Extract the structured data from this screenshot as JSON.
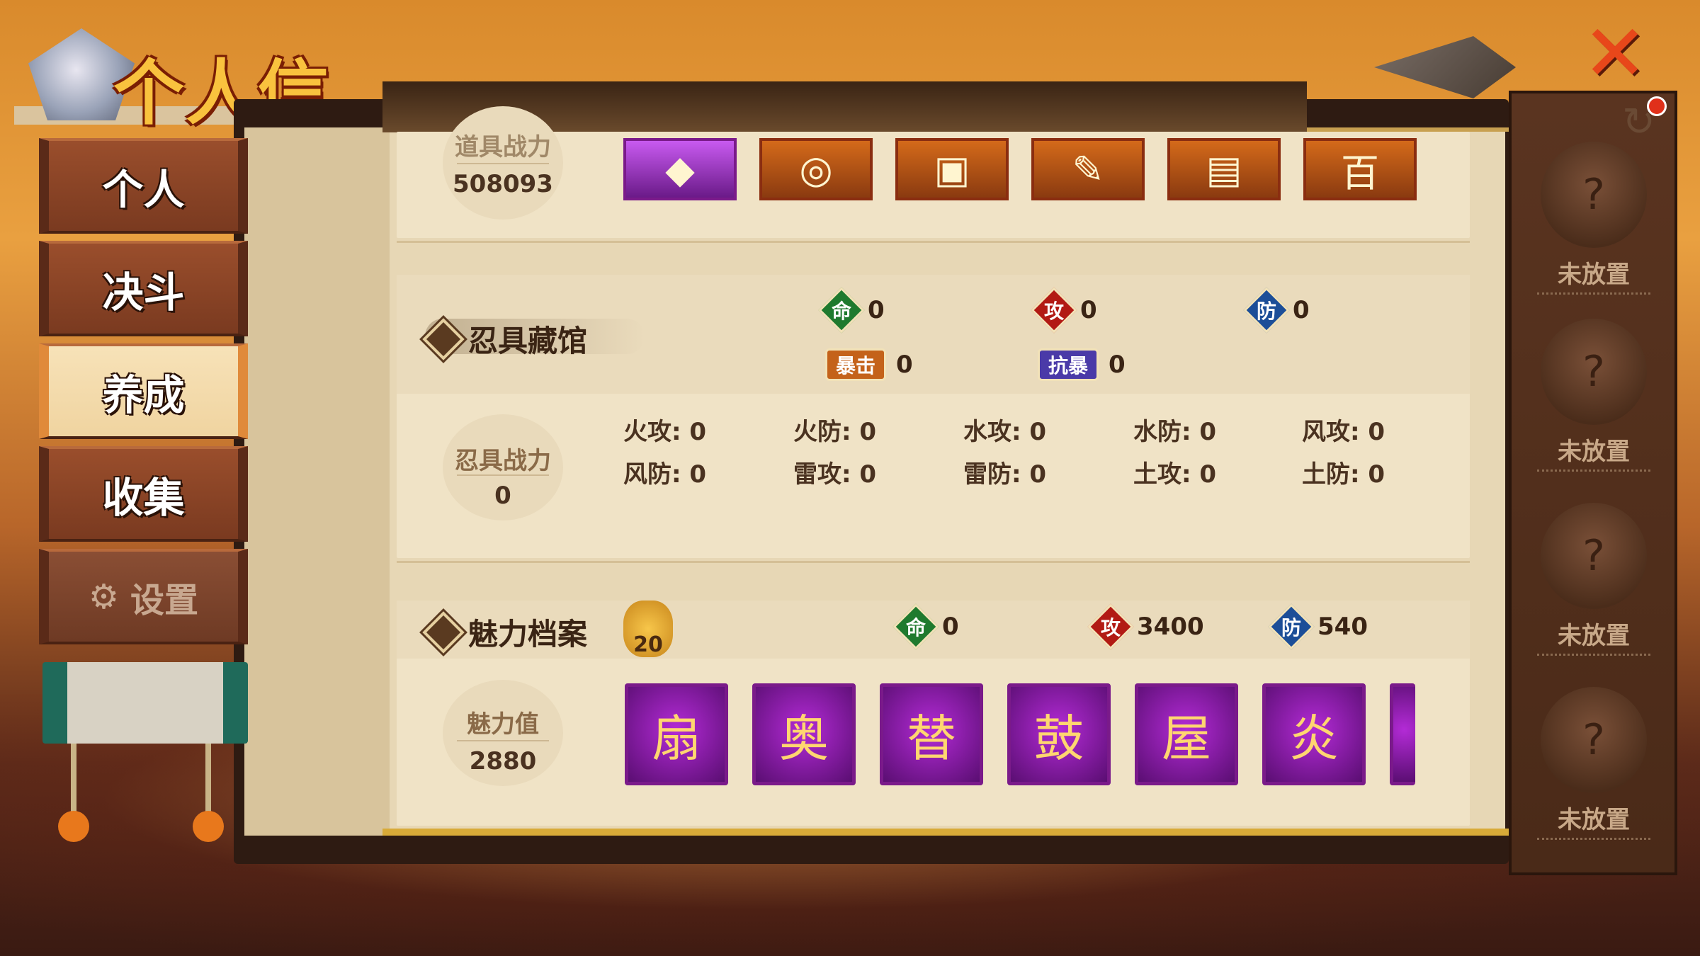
{
  "title": "个人信息",
  "nav": {
    "items": [
      "个人",
      "决斗",
      "养成",
      "收集"
    ],
    "active": "养成",
    "settings_label": "设置"
  },
  "top": {
    "power_label": "道具战力",
    "power_value": "508093",
    "items": [
      "◆",
      "◎",
      "▣",
      "✎",
      "▤",
      "百"
    ]
  },
  "ninja_tools": {
    "title": "忍具藏馆",
    "stats": {
      "life_icon": "命",
      "life_value": "0",
      "attack_icon": "攻",
      "attack_value": "0",
      "defense_icon": "防",
      "defense_value": "0",
      "crit_icon": "暴击",
      "crit_value": "0",
      "anticrit_icon": "抗暴",
      "anticrit_value": "0"
    },
    "power_label": "忍具战力",
    "power_value": "0",
    "elements": [
      [
        "火攻: 0",
        "火防: 0",
        "水攻: 0",
        "水防: 0",
        "风攻: 0"
      ],
      [
        "风防: 0",
        "雷攻: 0",
        "雷防: 0",
        "土攻: 0",
        "土防: 0"
      ]
    ]
  },
  "charm": {
    "title": "魅力档案",
    "level": "20",
    "stats": {
      "life_icon": "命",
      "life_value": "0",
      "attack_icon": "攻",
      "attack_value": "3400",
      "defense_icon": "防",
      "defense_value": "540"
    },
    "value_label": "魅力值",
    "value": "2880",
    "items": [
      "扇",
      "奥",
      "替",
      "鼓",
      "屋",
      "炎"
    ]
  },
  "slots": {
    "label": "未放置",
    "count": 4
  },
  "colors": {
    "accent_orange": "#e8471a",
    "stat_green": "#1f7a2e",
    "stat_red": "#b21a14",
    "stat_blue": "#1c4e98",
    "charm_purple": "#7a1a8a"
  }
}
